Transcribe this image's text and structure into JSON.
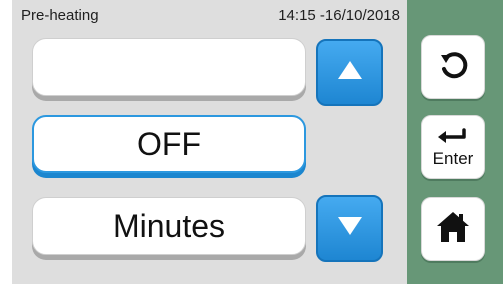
{
  "status": {
    "title": "Pre-heating",
    "datetime": "14:15 -16/10/2018"
  },
  "fields": {
    "top_value": "",
    "middle_value": "OFF",
    "bottom_value": "Minutes"
  },
  "side_buttons": {
    "enter_label": "Enter"
  },
  "icons": {
    "up": "up-triangle-icon",
    "down": "down-triangle-icon",
    "back": "reload-arrow-icon",
    "enter": "enter-arrow-icon",
    "home": "home-icon"
  },
  "colors": {
    "accent_blue": "#2c98df",
    "side_green": "#679777",
    "panel_gray": "#dedede"
  }
}
